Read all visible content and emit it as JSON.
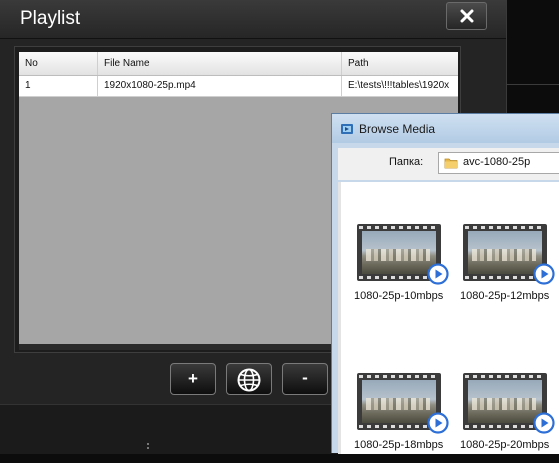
{
  "playlist": {
    "title": "Playlist",
    "columns": [
      "No",
      "File Name",
      "Path"
    ],
    "rows": [
      {
        "no": "1",
        "file_name": "1920x1080-25p.mp4",
        "path": "E:\\tests\\!!!tables\\1920x"
      }
    ],
    "buttons": {
      "add": "+",
      "web": "globe-icon",
      "remove": "-"
    }
  },
  "browse": {
    "title": "Browse Media",
    "folder_label": "Папка:",
    "folder_value": "avc-1080-25p",
    "items": [
      {
        "label": "1080-25p-10mbps"
      },
      {
        "label": "1080-25p-12mbps"
      },
      {
        "label": "1080-25p-18mbps"
      },
      {
        "label": "1080-25p-20mbps"
      }
    ]
  }
}
